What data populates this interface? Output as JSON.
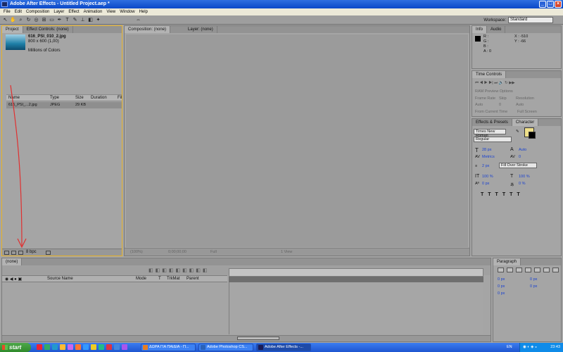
{
  "window": {
    "title": "Adobe After Effects - Untitled Project.aep *"
  },
  "menu": [
    "File",
    "Edit",
    "Composition",
    "Layer",
    "Effect",
    "Animation",
    "View",
    "Window",
    "Help"
  ],
  "workspace": {
    "label": "Workspace:",
    "value": "Standard"
  },
  "project_panel": {
    "tab_project": "Project",
    "tab_effect_controls": "Effect Controls: (none)",
    "file_name": "616_PSI_010_2.jpg",
    "file_dims": "800 x 600 (1,00)",
    "file_colors": "Millions of Colors",
    "columns": [
      "Name",
      "Type",
      "Size",
      "Duration",
      "Fil"
    ],
    "rows": [
      {
        "name": "616_PSI_...2.jpg",
        "type": "JPEG",
        "size": "29 KB"
      }
    ],
    "bpc": "8 bpc"
  },
  "comp_panel": {
    "tab_comp": "Composition: (none)",
    "tab_layer": "Layer: (none)",
    "zoom": "(100%)",
    "timecode": "0;00;00;00",
    "quality": "Full",
    "view": "1 View"
  },
  "info_panel": {
    "tab_info": "Info",
    "tab_audio": "Audio",
    "r": "R :",
    "g": "G :",
    "b": "B :",
    "a": "A : 0",
    "x": "X : -510",
    "y": "Y : -66"
  },
  "time_controls": {
    "title": "Time Controls",
    "ram_preview": "RAM Preview Options",
    "frame_rate_label": "Frame Rate",
    "skip_label": "Skip",
    "resolution_label": "Resolution",
    "frame_rate": "Auto",
    "skip": "0",
    "resolution": "Auto",
    "from_current": "From Current Time",
    "full_screen": "Full Screen"
  },
  "character_panel": {
    "tab_effects": "Effects & Presets",
    "tab_character": "Character",
    "font": "Times New Roman",
    "style": "Regular",
    "size": "28 px",
    "leading": "Auto",
    "kerning": "Metrics",
    "tracking": "0",
    "stroke": "2 px",
    "stroke_mode": "Fill Over Stroke",
    "vscale": "100 %",
    "hscale": "100 %",
    "baseline": "0 px",
    "tsume": "0 %",
    "fill_color": "#efe08a",
    "stroke_color": "#000000"
  },
  "timeline": {
    "tab": "(none)",
    "columns": [
      "Source Name",
      "Mode",
      "T",
      "TrkMat",
      "Parent"
    ]
  },
  "paragraph_panel": {
    "tab": "Paragraph",
    "indent_left": "0 px",
    "indent_right": "0 px",
    "first_line": "0 px",
    "space_before": "0 px",
    "space_after": "0 px"
  },
  "taskbar": {
    "start": "start",
    "tasks": [
      {
        "label": "ΔΩΡΑ ΓΙΑ ΠΑΙΔΙΑ - Π...",
        "color": "#e67d22"
      },
      {
        "label": "Adobe Photoshop CS...",
        "color": "#2a62b8"
      },
      {
        "label": "Adobe After Effects -...",
        "color": "#1b1b55"
      }
    ],
    "lang": "EN",
    "clock": "23:43"
  }
}
